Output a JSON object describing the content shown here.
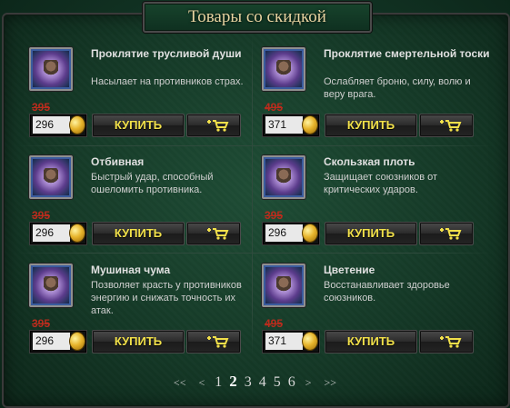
{
  "window": {
    "title": "Товары со скидкой"
  },
  "items": [
    {
      "name": "Проклятие трусливой души",
      "description": "Насылает на противников страх.",
      "old_price": "395",
      "price": "296",
      "buy_label": "КУПИТЬ",
      "icon": "cursed-creature-icon"
    },
    {
      "name": "Проклятие смертельной тоски",
      "description": "Ослабляет броню, силу, волю и веру врага.",
      "old_price": "495",
      "price": "371",
      "buy_label": "КУПИТЬ",
      "icon": "cursed-creature-icon"
    },
    {
      "name": "Отбивная",
      "description": "Быстрый удар, способный ошеломить противника.",
      "old_price": "395",
      "price": "296",
      "buy_label": "КУПИТЬ",
      "icon": "cursed-creature-icon"
    },
    {
      "name": "Скользкая плоть",
      "description": "Защищает союзников от критических ударов.",
      "old_price": "395",
      "price": "296",
      "buy_label": "КУПИТЬ",
      "icon": "cursed-creature-icon"
    },
    {
      "name": "Мушиная чума",
      "description": "Позволяет красть у противников энергию и снижать точность их атак.",
      "old_price": "395",
      "price": "296",
      "buy_label": "КУПИТЬ",
      "icon": "cursed-creature-icon"
    },
    {
      "name": "Цветение",
      "description": "Восстанавливает здоровье союзников.",
      "old_price": "495",
      "price": "371",
      "buy_label": "КУПИТЬ",
      "icon": "cursed-creature-icon"
    }
  ],
  "pagination": {
    "first": "<<",
    "prev": "<",
    "pages": [
      "1",
      "2",
      "3",
      "4",
      "5",
      "6"
    ],
    "current": "2",
    "next": ">",
    "last": ">>"
  },
  "colors": {
    "background": "#143826",
    "old_price": "#b82c1d",
    "button_text": "#f1e04a",
    "title_text": "#e7d3a0"
  }
}
